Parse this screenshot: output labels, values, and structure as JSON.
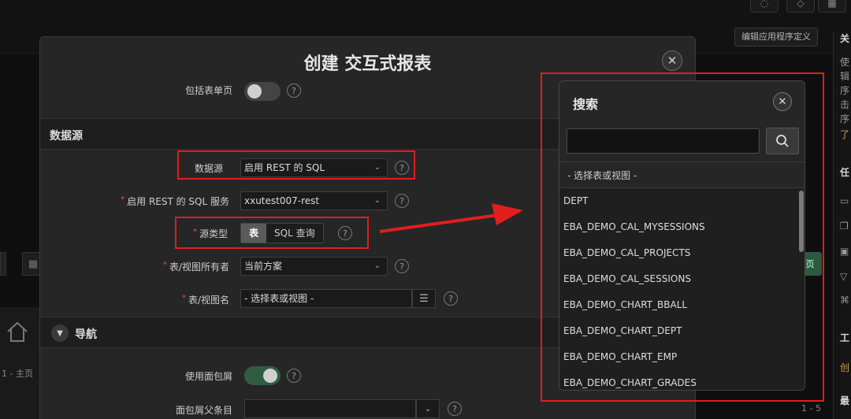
{
  "background": {
    "edit_app_def_label": "编辑应用程序定义",
    "home_label": "1 - 主页",
    "page_btn_label": "页",
    "pager_label": "1 - 5",
    "right_panel_chars": [
      "关",
      "使",
      "辑",
      "序",
      "击",
      "序",
      "了",
      "任",
      "工",
      "创",
      "最"
    ]
  },
  "modal": {
    "title": "创建 交互式报表",
    "close_glyph": "✕",
    "include_form_label": "包括表单页",
    "datasource_section": "数据源",
    "datasource_label": "数据源",
    "datasource_value": "启用 REST 的 SQL",
    "rest_service_label": "启用 REST 的 SQL 服务",
    "rest_service_value": "xxutest007-rest",
    "source_type_label": "源类型",
    "source_type_opt_table": "表",
    "source_type_opt_sql": "SQL 查询",
    "owner_label": "表/视图所有者",
    "owner_value": "当前方案",
    "table_name_label": "表/视图名",
    "table_name_value": "- 选择表或视图 -",
    "nav_section": "导航",
    "nav_toggle_glyph": "▼",
    "use_breadcrumb_label": "使用面包屑",
    "breadcrumb_parent_label": "面包屑父条目",
    "help_glyph": "?",
    "required_glyph": "*",
    "chevron_glyph": "⌄"
  },
  "popup": {
    "title": "搜索",
    "close_glyph": "✕",
    "search_value": "",
    "placeholder_option": "- 选择表或视图 -",
    "items": [
      "DEPT",
      "EBA_DEMO_CAL_MYSESSIONS",
      "EBA_DEMO_CAL_PROJECTS",
      "EBA_DEMO_CAL_SESSIONS",
      "EBA_DEMO_CHART_BBALL",
      "EBA_DEMO_CHART_DEPT",
      "EBA_DEMO_CHART_EMP",
      "EBA_DEMO_CHART_GRADES"
    ]
  },
  "colors": {
    "highlight": "#e11d1d",
    "toggle_on": "#2f5d41"
  }
}
